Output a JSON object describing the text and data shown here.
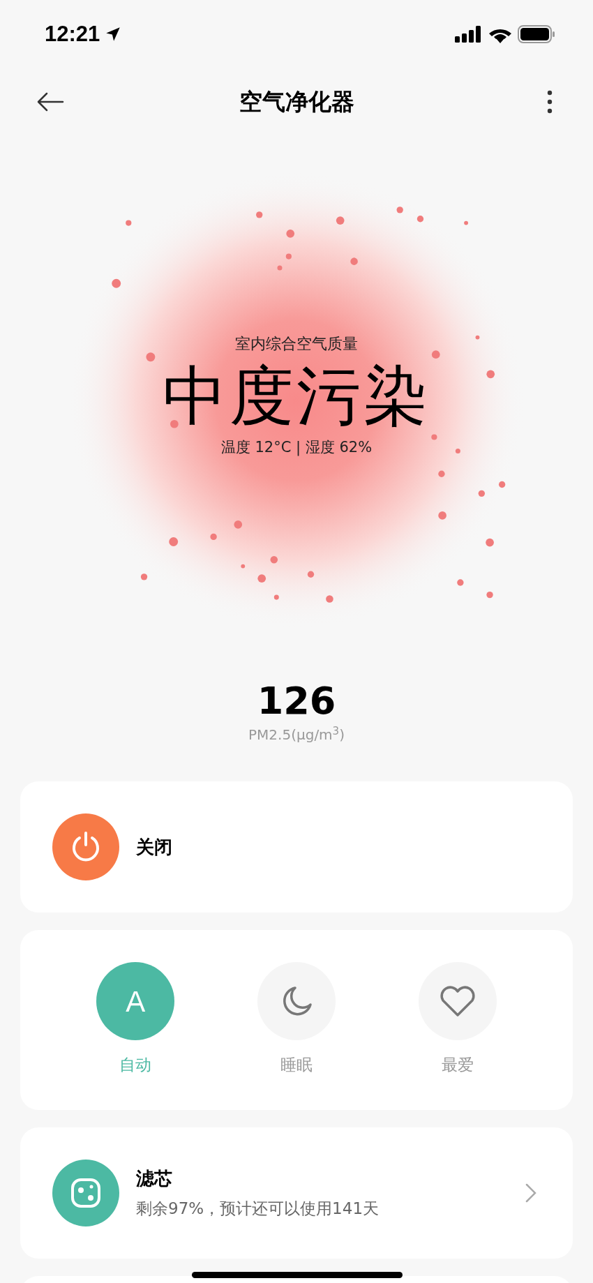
{
  "status_bar": {
    "time": "12:21"
  },
  "nav": {
    "title": "空气净化器"
  },
  "air_quality": {
    "caption": "室内综合空气质量",
    "level_text": "中度污染",
    "climate": "温度 12°C | 湿度 62%"
  },
  "pm25": {
    "value": "126",
    "unit": "PM2.5(μg/m$^{3}$)"
  },
  "power": {
    "label": "关闭",
    "on": false
  },
  "modes": [
    {
      "kind": "letter",
      "glyph": "A",
      "label": "自动",
      "selected": true
    },
    {
      "kind": "moon",
      "label": "睡眠",
      "selected": false
    },
    {
      "kind": "heart",
      "label": "最爱",
      "selected": false
    }
  ],
  "filter": {
    "title": "滤芯",
    "detail": "剩余97%，预计还可以使用141天"
  }
}
